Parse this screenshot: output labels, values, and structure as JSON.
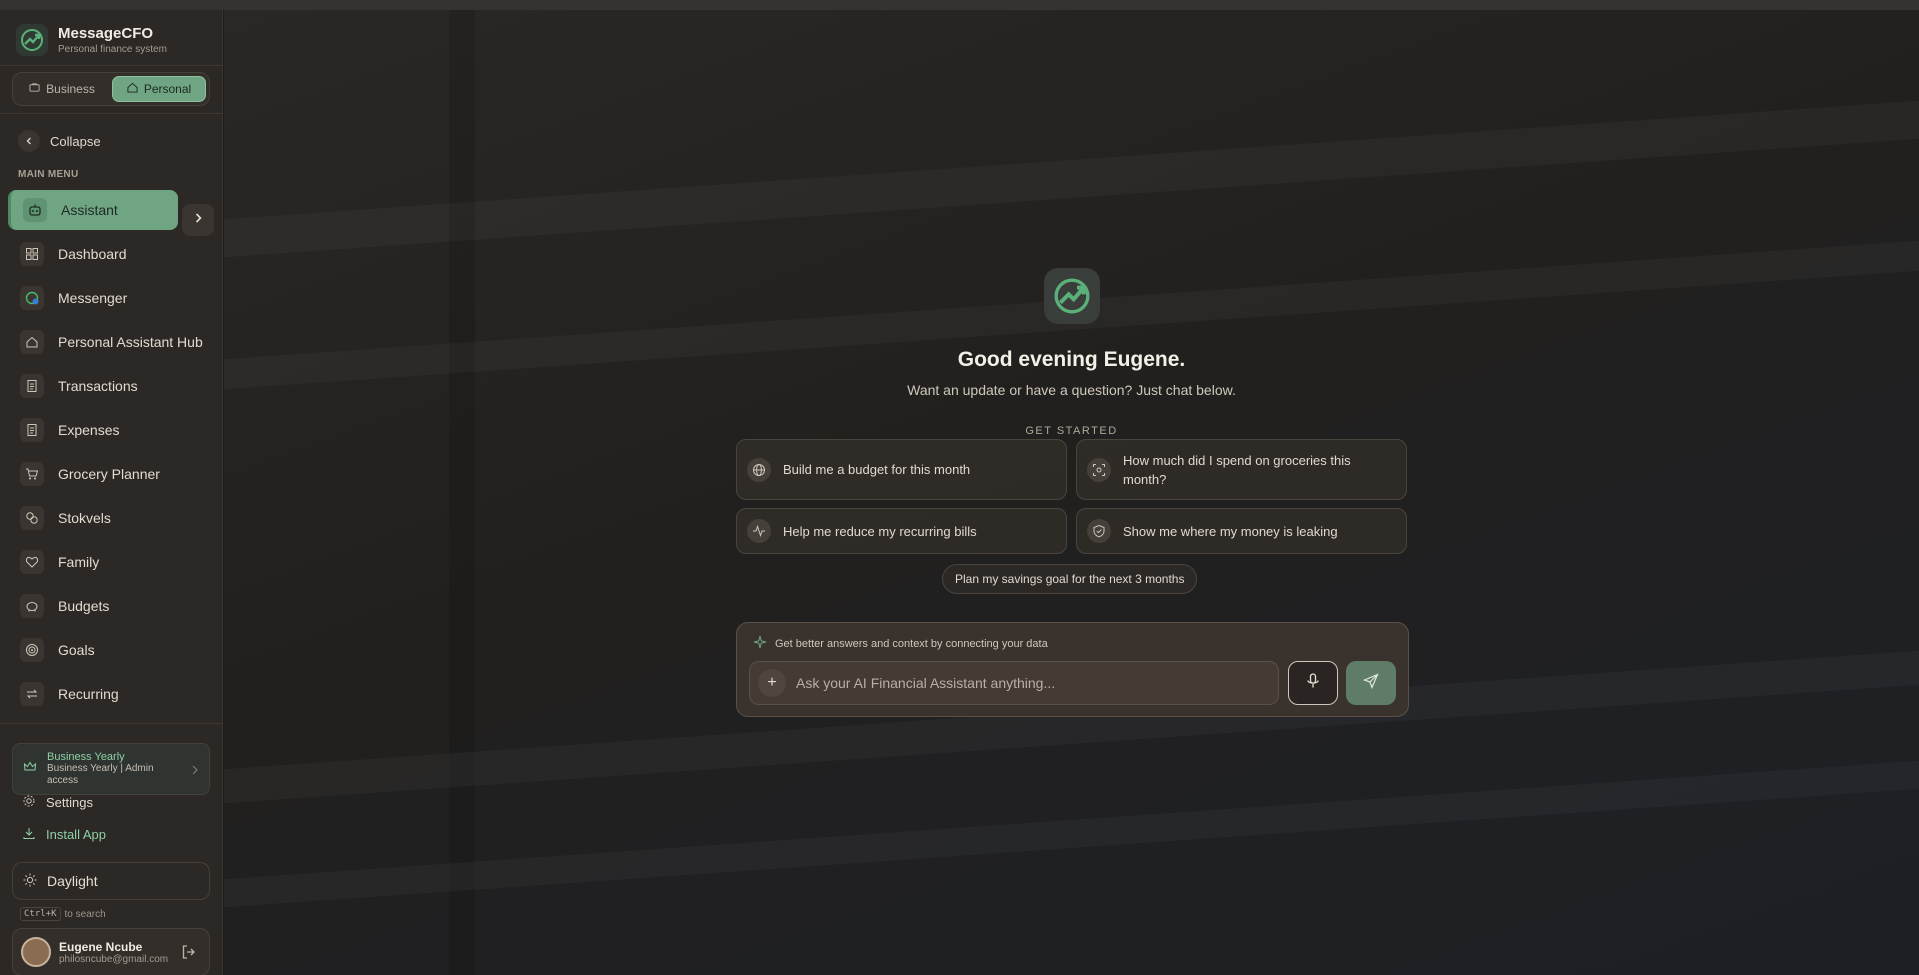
{
  "brand": {
    "name": "MessageCFO",
    "subtitle": "Personal finance system"
  },
  "mode_switch": {
    "business": "Business",
    "personal": "Personal",
    "active": "personal"
  },
  "collapse_label": "Collapse",
  "main_menu_label": "MAIN MENU",
  "nav": [
    {
      "label": "Assistant",
      "icon": "robot-icon",
      "active": true
    },
    {
      "label": "Dashboard",
      "icon": "grid-icon"
    },
    {
      "label": "Messenger",
      "icon": "whatsapp-icon"
    },
    {
      "label": "Personal Assistant Hub",
      "icon": "home-icon"
    },
    {
      "label": "Transactions",
      "icon": "receipt-icon"
    },
    {
      "label": "Expenses",
      "icon": "receipt-icon"
    },
    {
      "label": "Grocery Planner",
      "icon": "cart-icon"
    },
    {
      "label": "Stokvels",
      "icon": "coins-icon"
    },
    {
      "label": "Family",
      "icon": "heart-icon"
    },
    {
      "label": "Budgets",
      "icon": "piggy-bank-icon"
    },
    {
      "label": "Goals",
      "icon": "target-icon"
    },
    {
      "label": "Recurring",
      "icon": "repeat-icon"
    }
  ],
  "plan": {
    "title": "Business Yearly",
    "subtitle": "Business Yearly | Admin access"
  },
  "settings_label": "Settings",
  "install_label": "Install App",
  "theme_label": "Daylight",
  "search_hint": {
    "kbd": "Ctrl+K",
    "text": "to search"
  },
  "user": {
    "name": "Eugene Ncube",
    "email": "philosncube@gmail.com"
  },
  "main": {
    "greeting": "Good evening Eugene.",
    "subgreeting": "Want an update or have a question? Just chat below.",
    "get_started": "GET STARTED",
    "suggestions": [
      {
        "label": "Build me a budget for this month",
        "icon": "globe-icon"
      },
      {
        "label": "How much did I spend on groceries this month?",
        "icon": "scan-icon"
      },
      {
        "label": "Help me reduce my recurring bills",
        "icon": "activity-icon"
      },
      {
        "label": "Show me where my money is leaking",
        "icon": "shield-icon"
      }
    ],
    "pill": "Plan my savings goal for the next 3 months",
    "composer_hint": "Get better answers and context by connecting your data",
    "input_placeholder": "Ask your AI Financial Assistant anything..."
  },
  "colors": {
    "accent": "#6fa583",
    "sidebar_bg": "#2c2825",
    "send": "#5e7c66"
  }
}
